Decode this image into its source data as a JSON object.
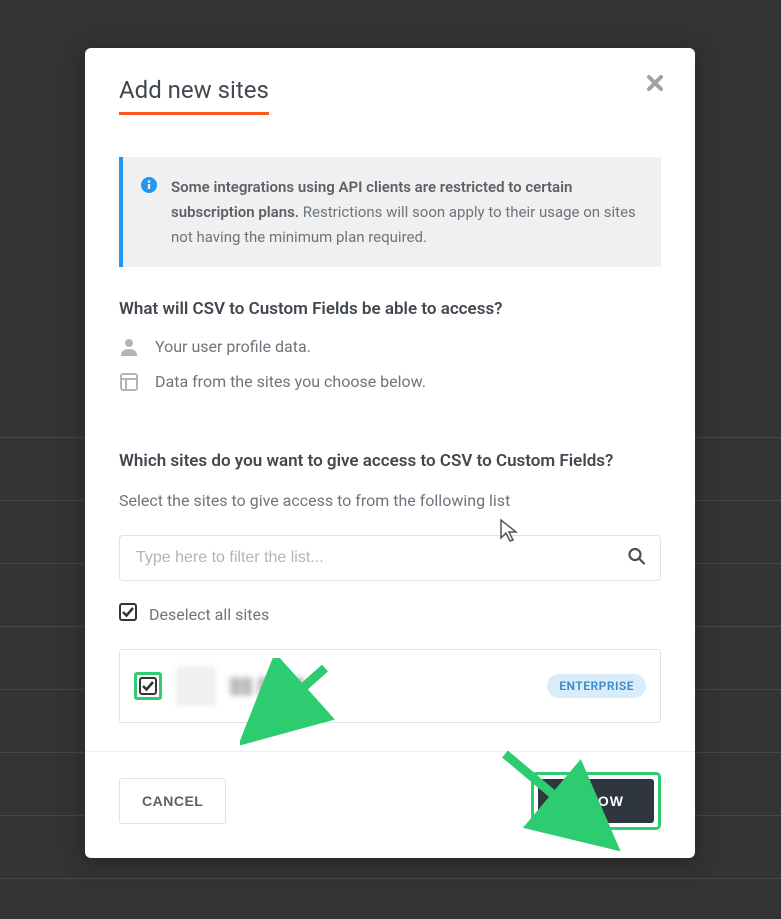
{
  "modal": {
    "title": "Add new sites",
    "info_banner": {
      "bold_text": "Some integrations using API clients are restricted to certain subscription plans.",
      "normal_text": " Restrictions will soon apply to their usage on sites not having the minimum plan required."
    },
    "access_section": {
      "heading": "What will CSV to Custom Fields be able to access?",
      "items": [
        {
          "icon": "user",
          "label": "Your user profile data."
        },
        {
          "icon": "layout",
          "label": "Data from the sites you choose below."
        }
      ]
    },
    "sites_section": {
      "heading": "Which sites do you want to give access to CSV to Custom Fields?",
      "instruction": "Select the sites to give access to from the following list",
      "filter_placeholder": "Type here to filter the list...",
      "deselect_label": "Deselect all sites",
      "sites": [
        {
          "name": "██ ████",
          "plan": "ENTERPRISE",
          "checked": true
        }
      ]
    },
    "footer": {
      "cancel_label": "CANCEL",
      "allow_label": "ALLOW"
    }
  },
  "colors": {
    "accent": "#ff5722",
    "info": "#2196f3",
    "highlight": "#2ecc71",
    "primary_button": "#2f3640"
  }
}
